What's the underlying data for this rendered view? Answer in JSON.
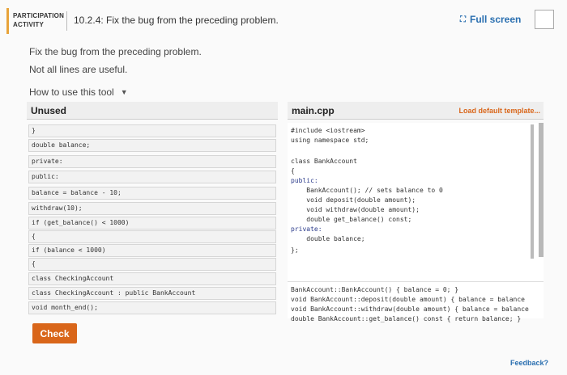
{
  "header": {
    "activity_label_line1": "PARTICIPATION",
    "activity_label_line2": "ACTIVITY",
    "title": "10.2.4: Fix the bug from the preceding problem.",
    "fullscreen_label": "Full screen"
  },
  "instructions": {
    "line1": "Fix the bug from the preceding problem.",
    "line2": "Not all lines are useful.",
    "how_to": "How to use this tool"
  },
  "unused": {
    "heading": "Unused",
    "lines": [
      "}",
      "double balance;",
      "private:",
      "public:",
      "balance = balance - 10;",
      "withdraw(10);",
      "if (get_balance() < 1000)",
      "{",
      "if (balance < 1000)",
      "{",
      "class CheckingAccount",
      "class CheckingAccount : public BankAccount",
      "void month_end();"
    ]
  },
  "main": {
    "filename": "main.cpp",
    "load_default": "Load default template...",
    "code": [
      "#include <iostream>",
      "using namespace std;",
      "",
      "class BankAccount",
      "{",
      "public:",
      "    BankAccount(); // sets balance to 0",
      "    void deposit(double amount);",
      "    void withdraw(double amount);",
      "    double get_balance() const;",
      "private:",
      "    double balance;",
      "};"
    ],
    "impl": [
      "BankAccount::BankAccount() { balance = 0; }",
      "void BankAccount::deposit(double amount) { balance = balance",
      "void BankAccount::withdraw(double amount) { balance = balance",
      "double BankAccount::get_balance() const { return balance; }"
    ]
  },
  "actions": {
    "check": "Check",
    "feedback": "Feedback?"
  },
  "colors": {
    "accent": "#e8a33a",
    "primary_button": "#d9661a",
    "link": "#2a6fb0"
  }
}
